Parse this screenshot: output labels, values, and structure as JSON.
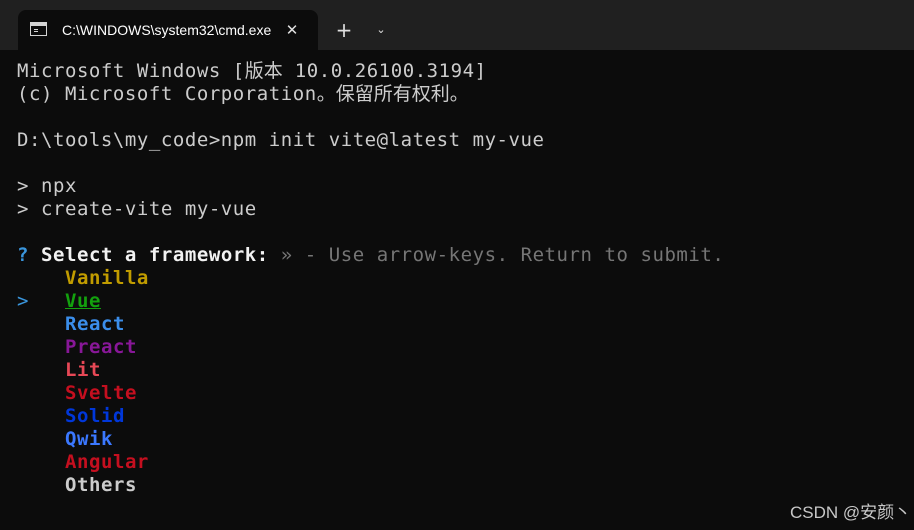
{
  "window": {
    "tab_title": "C:\\WINDOWS\\system32\\cmd.exe",
    "tab_icon": "console-icon",
    "close_glyph": "✕",
    "new_tab_glyph": "+",
    "dropdown_glyph": "⌄"
  },
  "terminal": {
    "banner_line1_a": "Microsoft Windows [",
    "banner_line1_cjk": "版本",
    "banner_line1_b": " 10.0.26100.3194]",
    "banner_line2_a": "(c) Microsoft Corporation",
    "banner_line2_cjk": "。保留所有权利。",
    "command": "D:\\tools\\my_code>npm init vite@latest my-vue",
    "npx_line": "> npx",
    "create_line": "> create-vite my-vue",
    "question_mark": "?",
    "question": "Select a framework:",
    "hint": "» - Use arrow-keys. Return to submit.",
    "cursor": ">",
    "options": [
      {
        "label": "Vanilla",
        "color": "#c19c00"
      },
      {
        "label": "Vue",
        "color": "#13a10e",
        "selected": true
      },
      {
        "label": "React",
        "color": "#3b8eea"
      },
      {
        "label": "Preact",
        "color": "#881798"
      },
      {
        "label": "Lit",
        "color": "#e74856"
      },
      {
        "label": "Svelte",
        "color": "#c50f1f"
      },
      {
        "label": "Solid",
        "color": "#0037da"
      },
      {
        "label": "Qwik",
        "color": "#3b78ff"
      },
      {
        "label": "Angular",
        "color": "#c50f1f"
      },
      {
        "label": "Others",
        "color": "#cccccc"
      }
    ]
  },
  "watermark": "CSDN @安颜丶",
  "colors": {
    "background": "#0c0c0c",
    "titlebar": "#202020",
    "foreground": "#cccccc",
    "accent": "#3a96dd"
  }
}
